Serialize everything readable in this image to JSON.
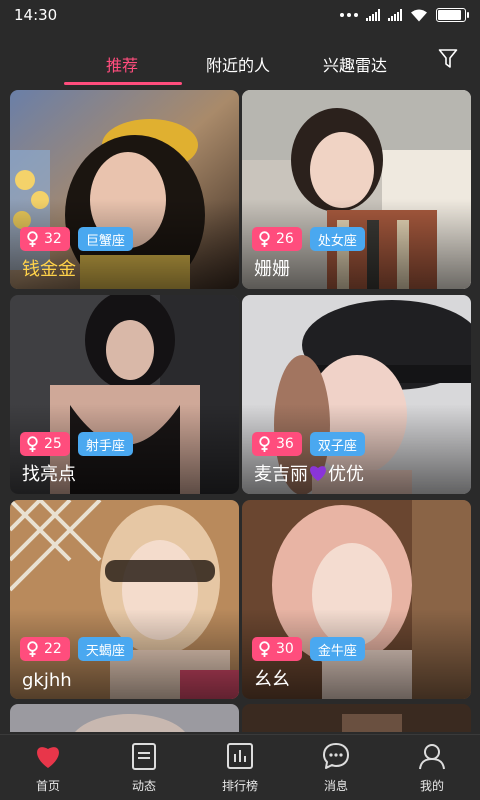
{
  "status_bar": {
    "time": "14:30",
    "battery_level": 0.9
  },
  "tabs": [
    {
      "label": "推荐",
      "active": true
    },
    {
      "label": "附近的人",
      "active": false
    },
    {
      "label": "兴趣雷达",
      "active": false
    }
  ],
  "cards": [
    {
      "age": "32",
      "zodiac": "巨蟹座",
      "name": "钱金金",
      "name_color": "#ffd24a"
    },
    {
      "age": "26",
      "zodiac": "处女座",
      "name": "姗姗"
    },
    {
      "age": "25",
      "zodiac": "射手座",
      "name": "找亮点"
    },
    {
      "age": "36",
      "zodiac": "双子座",
      "name_prefix": "麦吉丽",
      "name_suffix": "优优",
      "name_emoji": "purple-heart-icon"
    },
    {
      "age": "22",
      "zodiac": "天蝎座",
      "name": "gkjhh"
    },
    {
      "age": "30",
      "zodiac": "金牛座",
      "name": "幺幺"
    }
  ],
  "bottom_nav": [
    {
      "label": "首页",
      "icon": "heart-icon",
      "active": true
    },
    {
      "label": "动态",
      "icon": "document-icon"
    },
    {
      "label": "排行榜",
      "icon": "ranking-chart-icon"
    },
    {
      "label": "消息",
      "icon": "chat-bubble-icon"
    },
    {
      "label": "我的",
      "icon": "user-icon"
    }
  ],
  "colors": {
    "accent": "#ff4d7d",
    "zodiac": "#4aa8f0",
    "background": "#2a2a2a"
  }
}
